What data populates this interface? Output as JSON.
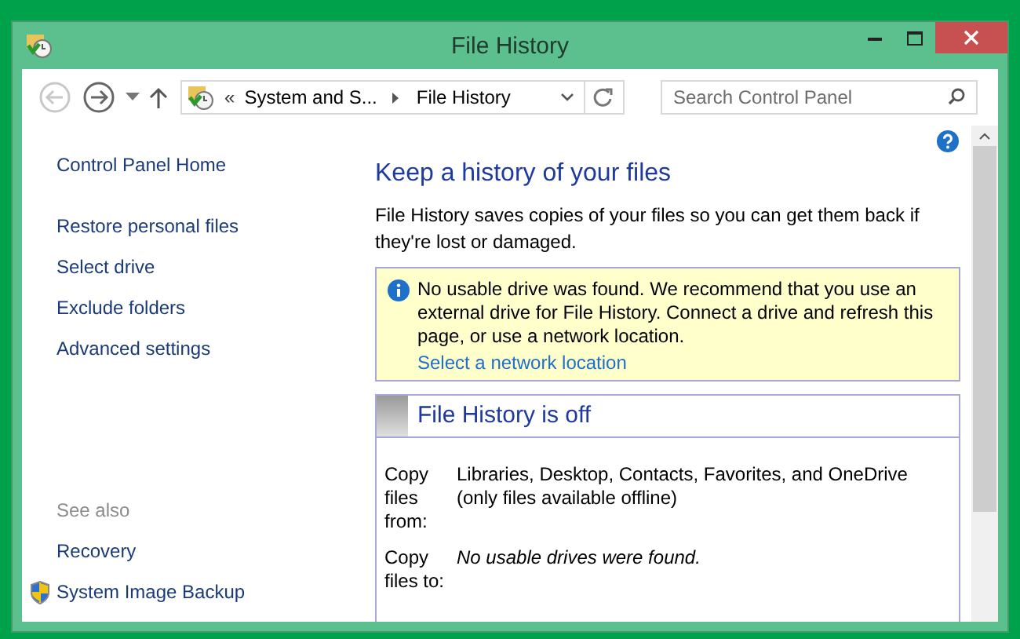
{
  "window": {
    "title": "File History"
  },
  "address_bar": {
    "overflow": "«",
    "crumbs": [
      "System and S...",
      "File History"
    ]
  },
  "search": {
    "placeholder": "Search Control Panel"
  },
  "sidebar": {
    "home": "Control Panel Home",
    "items": [
      "Restore personal files",
      "Select drive",
      "Exclude folders",
      "Advanced settings"
    ],
    "see_also_heading": "See also",
    "see_also": [
      {
        "label": "Recovery",
        "shield": false
      },
      {
        "label": "System Image Backup",
        "shield": true
      }
    ]
  },
  "main": {
    "heading": "Keep a history of your files",
    "description": "File History saves copies of your files so you can get them back if they're lost or damaged.",
    "notice": {
      "text": "No usable drive was found. We recommend that you use an external drive for File History. Connect a drive and refresh this page, or use a network location.",
      "link": "Select a network location"
    },
    "status": {
      "title": "File History is off",
      "rows": [
        {
          "label": "Copy files from:",
          "value": "Libraries, Desktop, Contacts, Favorites, and OneDrive (only files available offline)",
          "kind": "normal"
        },
        {
          "label": "Copy files to:",
          "value": "No usable drives were found.",
          "kind": "note"
        }
      ]
    }
  }
}
